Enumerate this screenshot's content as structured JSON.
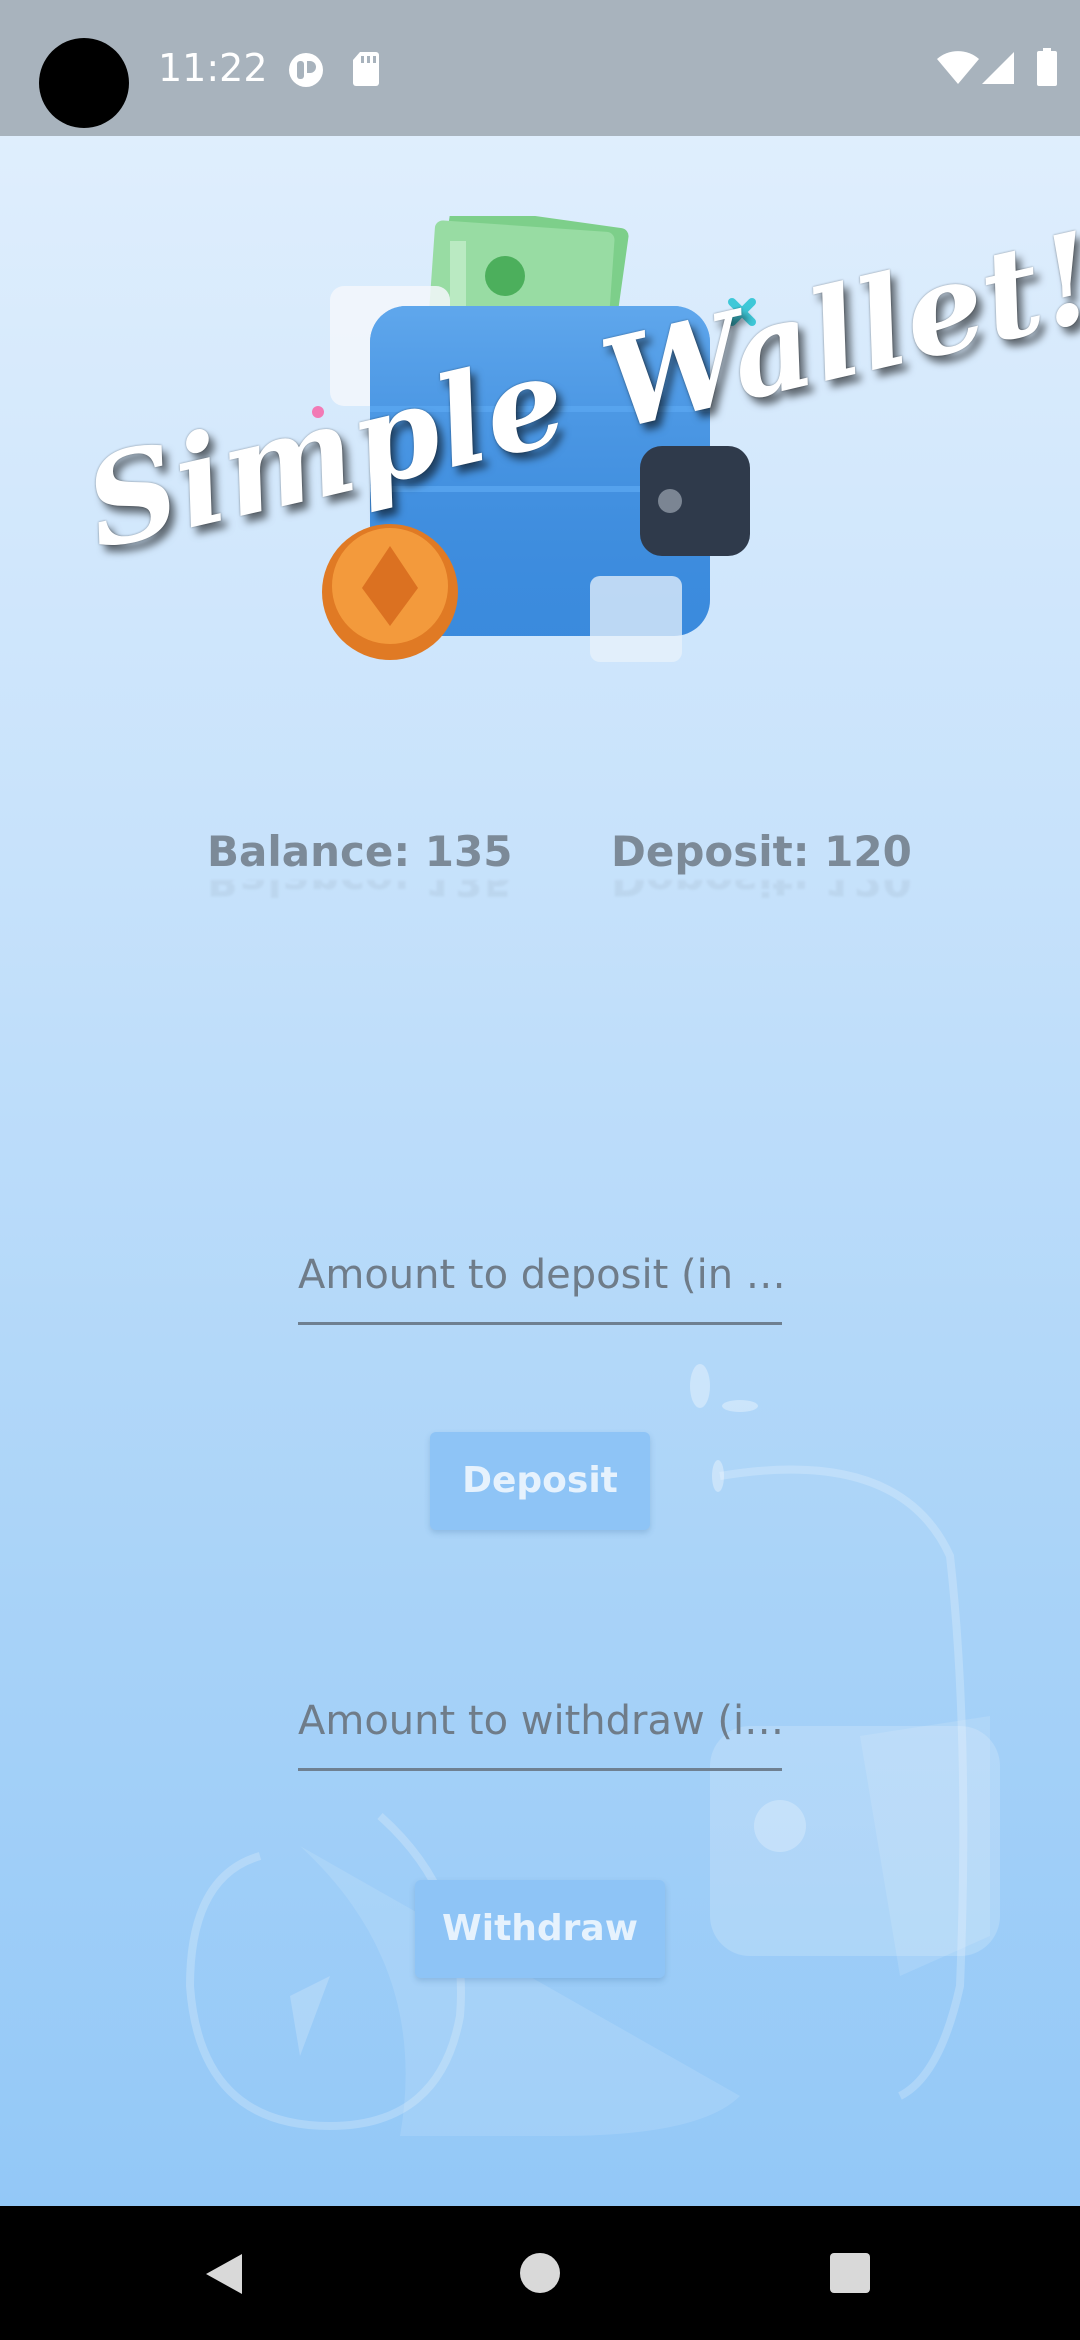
{
  "status_bar": {
    "time": "11:22",
    "icons": [
      "camera-cutout",
      "app-notification-icon",
      "sd-card-icon",
      "wifi-icon",
      "signal-icon",
      "battery-icon"
    ]
  },
  "app": {
    "title": "Simple Wallet!",
    "hero_image": "wallet-with-cash-and-coin-illustration",
    "stats": {
      "balance_label": "Balance: 135",
      "deposit_label": "Deposit: 120"
    },
    "deposit_input": {
      "placeholder": "Amount to deposit (in …",
      "value": ""
    },
    "deposit_button_label": "Deposit",
    "withdraw_input": {
      "placeholder": "Amount to withdraw (i…",
      "value": ""
    },
    "withdraw_button_label": "Withdraw"
  },
  "nav_bar": {
    "icons": [
      "back-icon",
      "home-icon",
      "recents-icon"
    ]
  },
  "colors": {
    "status_bar_bg": "#a8b3bd",
    "background_top": "#dfeefd",
    "background_bottom": "#93c8f7",
    "stat_text": "#7c8a98",
    "button_bg": "#8ec4f6",
    "button_text": "#e6f2fd",
    "input_underline": "#6f8091"
  }
}
